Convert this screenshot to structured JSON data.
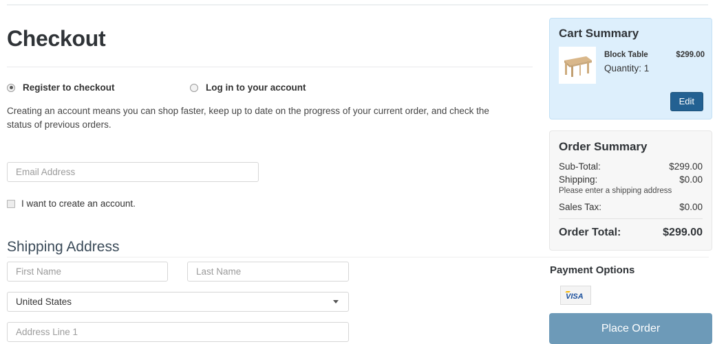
{
  "page": {
    "title": "Checkout"
  },
  "account_options": {
    "register": {
      "label": "Register to checkout",
      "selected": true
    },
    "login": {
      "label": "Log in to your account",
      "selected": false
    },
    "helper_text": "Creating an account means you can shop faster, keep up to date on the progress of your current order, and check the status of previous orders."
  },
  "email": {
    "placeholder": "Email Address",
    "value": ""
  },
  "create_account": {
    "label": "I want to create an account.",
    "checked": false
  },
  "shipping": {
    "section_title": "Shipping Address",
    "first_name": {
      "placeholder": "First Name",
      "value": ""
    },
    "last_name": {
      "placeholder": "Last Name",
      "value": ""
    },
    "country": {
      "selected": "United States"
    },
    "address_line_1": {
      "placeholder": "Address Line 1",
      "value": ""
    }
  },
  "cart_summary": {
    "heading": "Cart Summary",
    "items": [
      {
        "name": "Block Table",
        "price": "$299.00",
        "quantity_label": "Quantity: 1",
        "thumbnail": "wooden-table-image"
      }
    ],
    "edit_label": "Edit"
  },
  "order_summary": {
    "heading": "Order Summary",
    "rows": [
      {
        "label": "Sub-Total:",
        "value": "$299.00"
      },
      {
        "label": "Shipping:",
        "value": "$0.00",
        "note": "Please enter a shipping address"
      },
      {
        "label": "Sales Tax:",
        "value": "$0.00"
      }
    ],
    "total_label": "Order Total:",
    "total_value": "$299.00"
  },
  "payment": {
    "heading": "Payment Options",
    "methods": [
      {
        "name": "visa-card-icon",
        "label": "VISA"
      }
    ],
    "place_order_label": "Place Order"
  },
  "colors": {
    "cart_panel_bg": "#ddeffc",
    "cart_panel_border": "#c2e0f5",
    "order_panel_bg": "#f7f7f7",
    "edit_button": "#236192",
    "place_order_button": "#6d9ab8",
    "visa_blue": "#1a1f71",
    "visa_gold": "#f7b600"
  }
}
